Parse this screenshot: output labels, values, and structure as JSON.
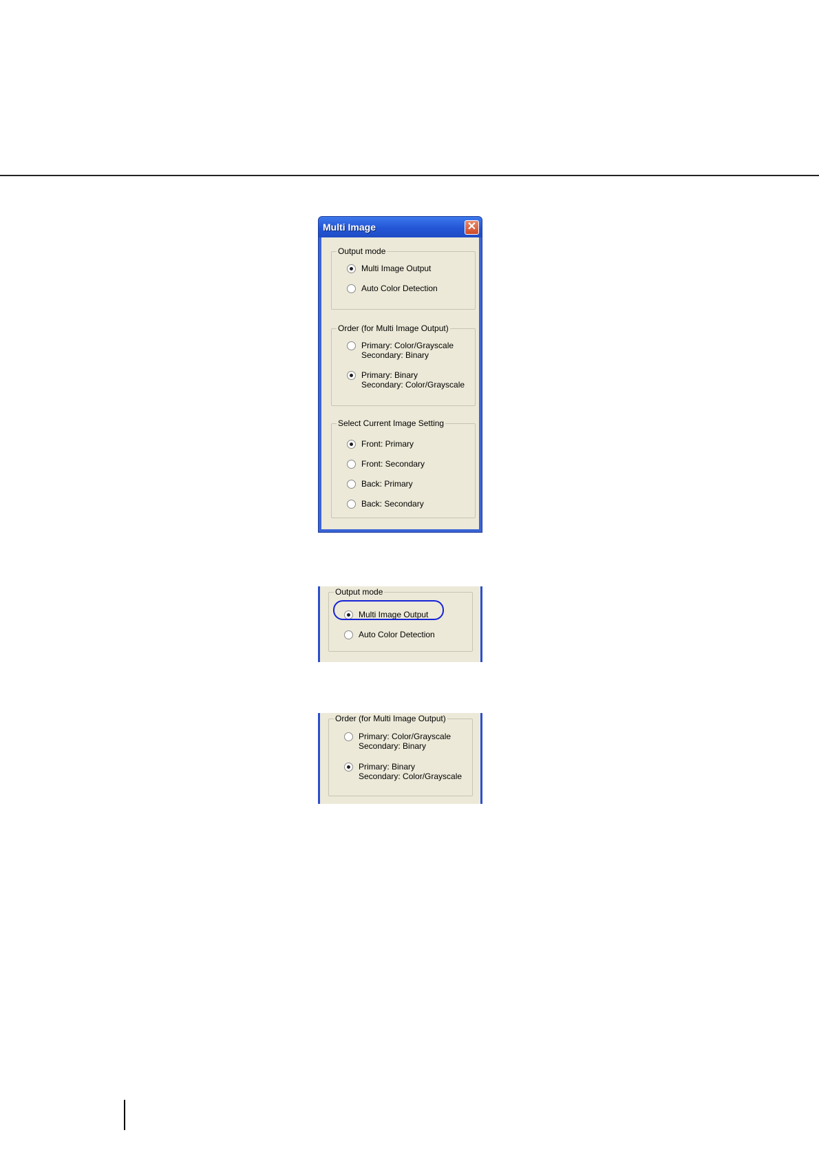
{
  "dialog": {
    "title": "Multi Image",
    "close_glyph": "✕",
    "output_mode": {
      "legend": "Output mode",
      "options": [
        {
          "label": "Multi Image Output",
          "checked": true
        },
        {
          "label": "Auto Color Detection",
          "checked": false
        }
      ]
    },
    "order": {
      "legend": "Order (for Multi Image Output)",
      "options": [
        {
          "line1": "Primary: Color/Grayscale",
          "line2": "Secondary: Binary",
          "checked": false
        },
        {
          "line1": "Primary: Binary",
          "line2": "Secondary: Color/Grayscale",
          "checked": true
        }
      ]
    },
    "current_setting": {
      "legend": "Select Current Image Setting",
      "options": [
        {
          "label": "Front: Primary",
          "checked": true
        },
        {
          "label": "Front: Secondary",
          "checked": false
        },
        {
          "label": "Back: Primary",
          "checked": false
        },
        {
          "label": "Back: Secondary",
          "checked": false
        }
      ]
    }
  },
  "highlight_color": "#1522d8",
  "window_color": "#3a64d6",
  "panel_background": "#ece9d8"
}
